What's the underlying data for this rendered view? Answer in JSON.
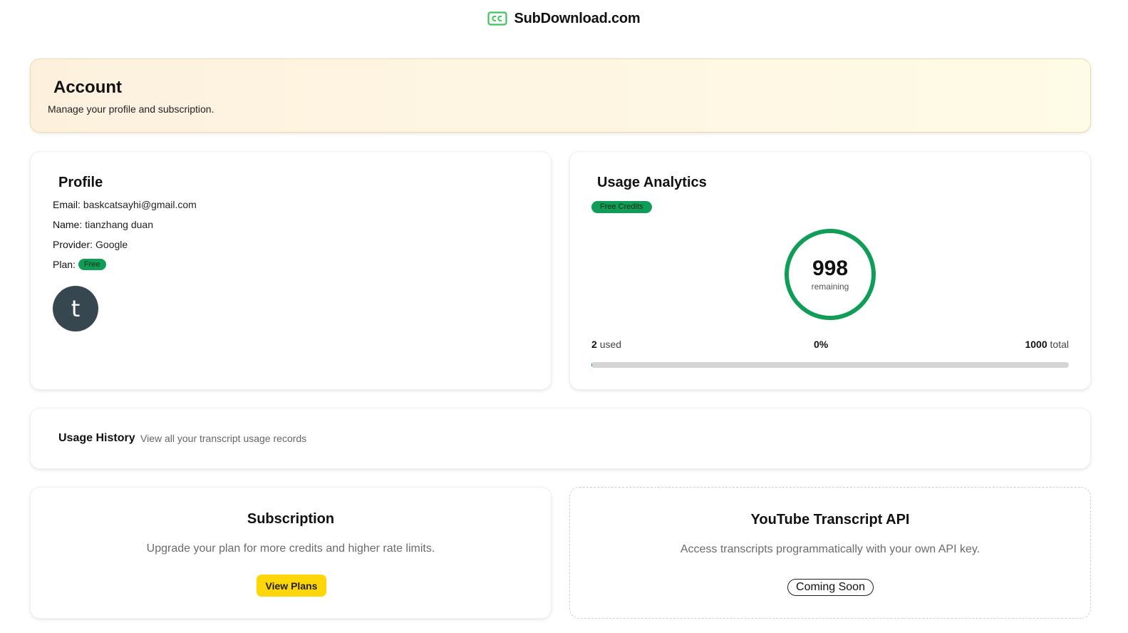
{
  "header": {
    "brand": "SubDownload.com",
    "logo_icon": "cc-caption-icon",
    "brand_color": "#3cc45d"
  },
  "account": {
    "title": "Account",
    "subtitle": "Manage your profile and subscription."
  },
  "profile": {
    "title": "Profile",
    "email_label": "Email:",
    "email": "baskcatsayhi@gmail.com",
    "name_label": "Name:",
    "name": "tianzhang duan",
    "provider_label": "Provider:",
    "provider": "Google",
    "plan_label": "Plan:",
    "plan": "Free",
    "avatar_letter": "t"
  },
  "usage": {
    "title": "Usage Analytics",
    "badge": "Free Credits",
    "remaining": "998",
    "remaining_label": "remaining",
    "used_value": "2",
    "used_label": "used",
    "percent": "0%",
    "total_value": "1000",
    "total_label": "total",
    "used_fraction": 0.002,
    "accent": "#0f9d58"
  },
  "history": {
    "title": "Usage History",
    "subtitle": "View all your transcript usage records"
  },
  "subscription": {
    "title": "Subscription",
    "description": "Upgrade your plan for more credits and higher rate limits.",
    "button": "View Plans",
    "button_color": "#ffd60a"
  },
  "api": {
    "title": "YouTube Transcript API",
    "description": "Access transcripts programmatically with your own API key.",
    "button": "Coming Soon"
  }
}
